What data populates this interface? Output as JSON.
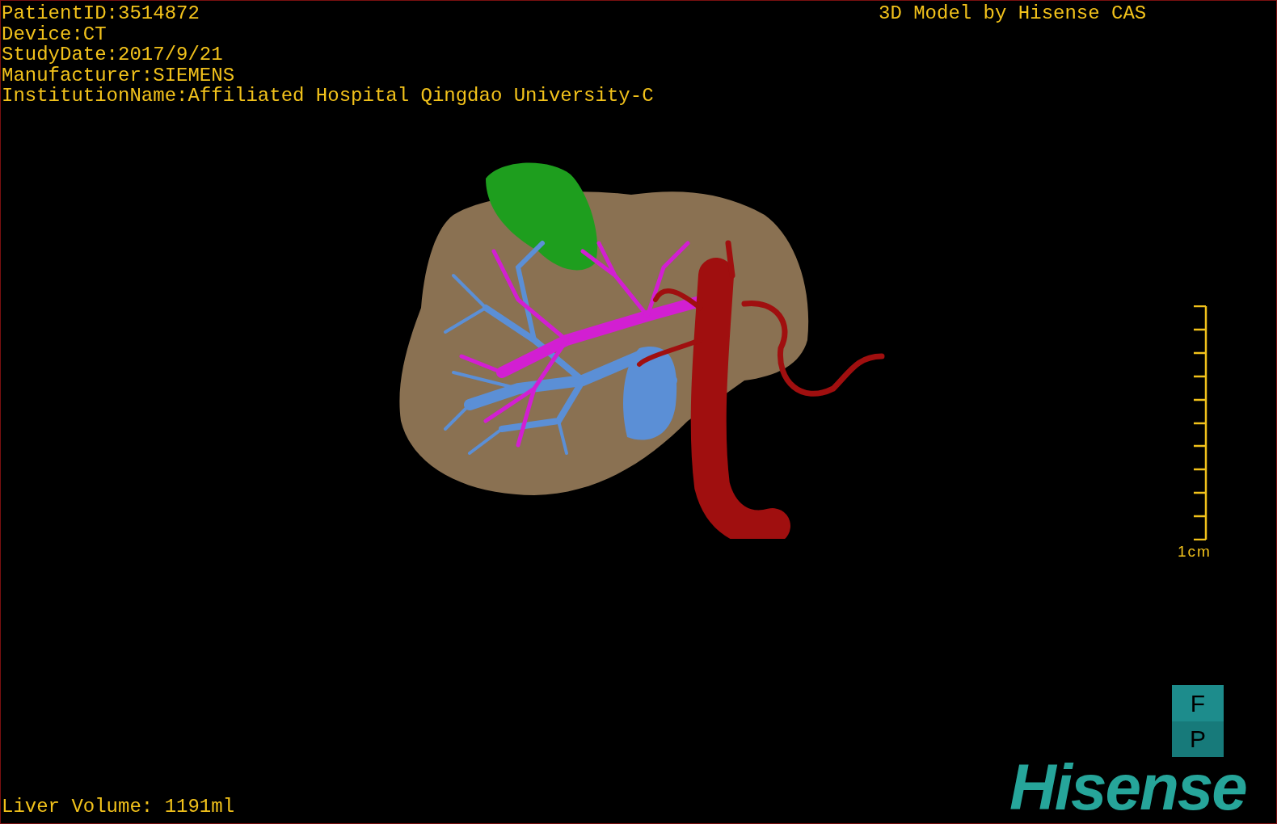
{
  "overlay_info": [
    "PatientID:3514872",
    "Device:CT",
    "StudyDate:2017/9/21",
    "Manufacturer:SIEMENS",
    "InstitutionName:Affiliated Hospital Qingdao University-C"
  ],
  "title": "3D Model by Hisense CAS",
  "scale_bar": {
    "label": "1cm"
  },
  "orientation_marker": [
    "F",
    "P"
  ],
  "logo": "Hisense",
  "liver_volume": "Liver Volume: 1191ml"
}
